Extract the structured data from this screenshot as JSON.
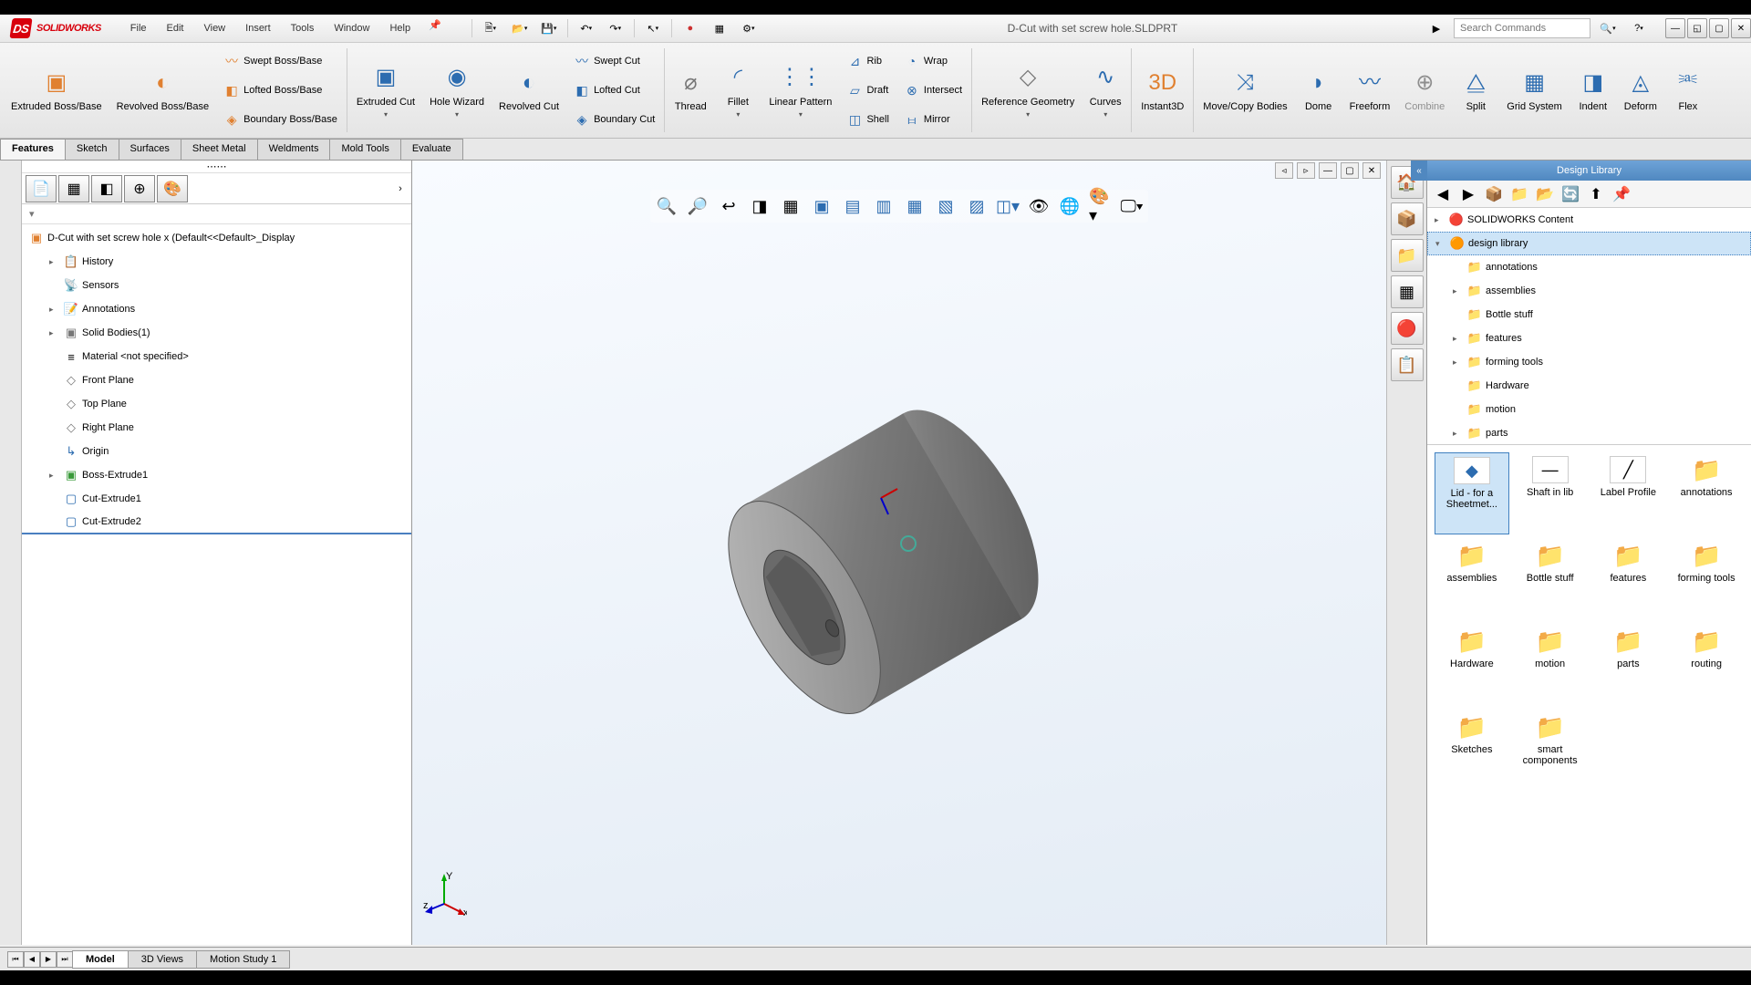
{
  "app_name": "SOLIDWORKS",
  "doc_title": "D-Cut with set screw hole.SLDPRT",
  "menus": [
    "File",
    "Edit",
    "View",
    "Insert",
    "Tools",
    "Window",
    "Help"
  ],
  "search_placeholder": "Search Commands",
  "ribbon": {
    "extruded_boss": "Extruded Boss/Base",
    "revolved_boss": "Revolved Boss/Base",
    "swept_boss": "Swept Boss/Base",
    "lofted_boss": "Lofted Boss/Base",
    "boundary_boss": "Boundary Boss/Base",
    "extruded_cut": "Extruded Cut",
    "hole_wizard": "Hole Wizard",
    "revolved_cut": "Revolved Cut",
    "swept_cut": "Swept Cut",
    "lofted_cut": "Lofted Cut",
    "boundary_cut": "Boundary Cut",
    "fillet": "Fillet",
    "linear_pattern": "Linear Pattern",
    "rib": "Rib",
    "draft": "Draft",
    "shell": "Shell",
    "wrap": "Wrap",
    "intersect": "Intersect",
    "mirror": "Mirror",
    "ref_geometry": "Reference Geometry",
    "curves": "Curves",
    "thread": "Thread",
    "instant3d": "Instant3D",
    "movecopy": "Move/Copy Bodies",
    "dome": "Dome",
    "freeform": "Freeform",
    "combine": "Combine",
    "split": "Split",
    "gridsystem": "Grid System",
    "indent": "Indent",
    "deform": "Deform",
    "flex": "Flex"
  },
  "tabs": [
    "Features",
    "Sketch",
    "Surfaces",
    "Sheet Metal",
    "Weldments",
    "Mold Tools",
    "Evaluate"
  ],
  "active_tab": "Features",
  "tree": {
    "root": "D-Cut with set screw hole x  (Default<<Default>_Display",
    "items": [
      {
        "label": "History",
        "icon": "📋"
      },
      {
        "label": "Sensors",
        "icon": "📡"
      },
      {
        "label": "Annotations",
        "icon": "📝",
        "expand": true
      },
      {
        "label": "Solid Bodies(1)",
        "icon": "▣",
        "expand": true
      },
      {
        "label": "Material <not specified>",
        "icon": "≡"
      },
      {
        "label": "Front Plane",
        "icon": "◇"
      },
      {
        "label": "Top Plane",
        "icon": "◇"
      },
      {
        "label": "Right Plane",
        "icon": "◇"
      },
      {
        "label": "Origin",
        "icon": "↳"
      },
      {
        "label": "Boss-Extrude1",
        "icon": "▣",
        "expand": true
      },
      {
        "label": "Cut-Extrude1",
        "icon": "▢"
      },
      {
        "label": "Cut-Extrude2",
        "icon": "▢"
      }
    ]
  },
  "design_library": {
    "title": "Design Library",
    "tree": [
      {
        "label": "SOLIDWORKS Content",
        "indent": 0,
        "icon": "🔴"
      },
      {
        "label": "design library",
        "indent": 0,
        "icon": "🟠",
        "selected": true,
        "expand": true
      },
      {
        "label": "annotations",
        "indent": 1,
        "icon": "📁"
      },
      {
        "label": "assemblies",
        "indent": 1,
        "icon": "📁"
      },
      {
        "label": "Bottle stuff",
        "indent": 1,
        "icon": "📁"
      },
      {
        "label": "features",
        "indent": 1,
        "icon": "📁"
      },
      {
        "label": "forming tools",
        "indent": 1,
        "icon": "📁"
      },
      {
        "label": "Hardware",
        "indent": 1,
        "icon": "📁"
      },
      {
        "label": "motion",
        "indent": 1,
        "icon": "📁"
      },
      {
        "label": "parts",
        "indent": 1,
        "icon": "📁"
      }
    ],
    "items": [
      {
        "label": "Lid -  for a Sheetmet...",
        "type": "file",
        "selected": true
      },
      {
        "label": "Shaft in lib",
        "type": "file"
      },
      {
        "label": "Label Profile",
        "type": "file"
      },
      {
        "label": "annotations",
        "type": "folder"
      },
      {
        "label": "assemblies",
        "type": "folder"
      },
      {
        "label": "Bottle stuff",
        "type": "folder"
      },
      {
        "label": "features",
        "type": "folder"
      },
      {
        "label": "forming tools",
        "type": "folder"
      },
      {
        "label": "Hardware",
        "type": "folder"
      },
      {
        "label": "motion",
        "type": "folder"
      },
      {
        "label": "parts",
        "type": "folder"
      },
      {
        "label": "routing",
        "type": "folder"
      },
      {
        "label": "Sketches",
        "type": "folder"
      },
      {
        "label": "smart components",
        "type": "folder"
      }
    ]
  },
  "bottom_tabs": [
    "Model",
    "3D Views",
    "Motion Study 1"
  ],
  "active_bottom_tab": "Model",
  "triad_labels": {
    "x": "x",
    "y": "Y",
    "z": "z"
  }
}
